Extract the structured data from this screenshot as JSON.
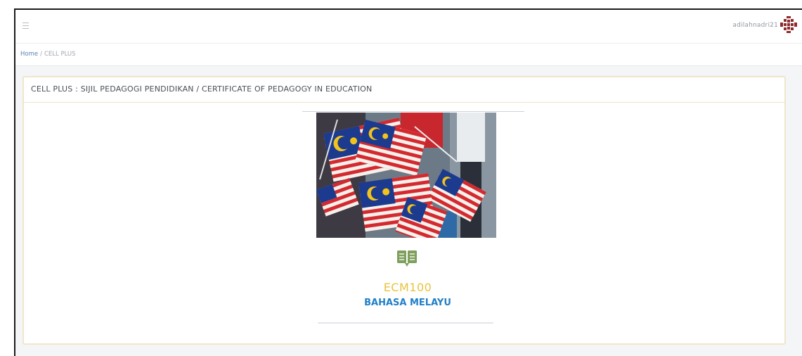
{
  "header": {
    "menu_icon": "hamburger-icon",
    "username": "adilahnadri21",
    "avatar_icon": "avatar-pattern-icon"
  },
  "breadcrumb": {
    "home": "Home",
    "separator": "/",
    "current": "CELL PLUS"
  },
  "panel": {
    "title": "CELL PLUS : SIJIL PEDAGOGI PENDIDIKAN / CERTIFICATE OF PEDAGOGY IN EDUCATION"
  },
  "course_card": {
    "image_icon": "malaysian-flags-image",
    "course_icon": "open-book-icon",
    "code": "ECM100",
    "name": "BAHASA MELAYU"
  },
  "colors": {
    "code": "#e8c33c",
    "name": "#1f7fc8",
    "book_icon": "#7ea05c",
    "panel_border": "#efe6c9"
  }
}
